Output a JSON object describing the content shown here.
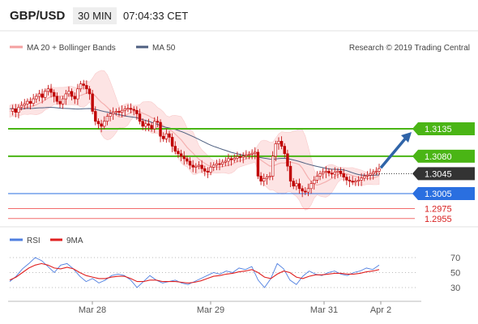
{
  "header": {
    "pair": "GBP/USD",
    "timeframe": "30 MIN",
    "time": "07:04:33 CET"
  },
  "legend": {
    "ma20": "MA 20 + Bollinger Bands",
    "ma50": "MA 50",
    "copyright": "Research © 2019 Trading Central"
  },
  "rsi_legend": {
    "rsi": "RSI",
    "ma9": "9MA"
  },
  "colors": {
    "candle": "#c00000",
    "band_fill": "#fde4e4",
    "ma20": "#f4b0b0",
    "ma50": "#4d5f80",
    "resistance": "#4ab515",
    "pivot": "#2a6fe0",
    "support": "#f26b6b",
    "current": "#333333",
    "arrow": "#2f64a8",
    "rsi": "#4f7fe0",
    "rsi_ma": "#e02020"
  },
  "chart_data": [
    {
      "type": "candlestick",
      "title": "",
      "x_ticks": [
        "Mar 28",
        "Mar 29",
        "Mar 31",
        "Apr 2"
      ],
      "price_levels": [
        {
          "value": 1.3135,
          "label": "1.3135",
          "kind": "resistance"
        },
        {
          "value": 1.308,
          "label": "1.3080",
          "kind": "resistance"
        },
        {
          "value": 1.3045,
          "label": "1.3045",
          "kind": "current"
        },
        {
          "value": 1.3005,
          "label": "1.3005",
          "kind": "pivot"
        },
        {
          "value": 1.2975,
          "label": "1.2975",
          "kind": "support"
        },
        {
          "value": 1.2955,
          "label": "1.2955",
          "kind": "support"
        }
      ],
      "price_series_estimated": [
        1.317,
        1.3175,
        1.3168,
        1.3178,
        1.3182,
        1.3185,
        1.319,
        1.3186,
        1.3195,
        1.32,
        1.3205,
        1.3198,
        1.321,
        1.3215,
        1.3208,
        1.32,
        1.319,
        1.3185,
        1.3195,
        1.3205,
        1.321,
        1.32,
        1.3195,
        1.3215,
        1.3225,
        1.3222,
        1.3215,
        1.3205,
        1.317,
        1.315,
        1.3145,
        1.314,
        1.315,
        1.316,
        1.3165,
        1.3168,
        1.317,
        1.3168,
        1.3172,
        1.3175,
        1.3176,
        1.3174,
        1.3172,
        1.3165,
        1.315,
        1.314,
        1.3145,
        1.3142,
        1.3135,
        1.315,
        1.3148,
        1.312,
        1.3115,
        1.3125,
        1.3118,
        1.31,
        1.309,
        1.3085,
        1.308,
        1.3075,
        1.307,
        1.3062,
        1.3058,
        1.306,
        1.3062,
        1.3055,
        1.305,
        1.3048,
        1.3058,
        1.3062,
        1.3065,
        1.3064,
        1.3068,
        1.307,
        1.3075,
        1.3073,
        1.3076,
        1.3079,
        1.3078,
        1.308,
        1.3082,
        1.3084,
        1.3086,
        1.3088,
        1.304,
        1.303,
        1.3035,
        1.3038,
        1.304,
        1.308,
        1.3105,
        1.311,
        1.31,
        1.3085,
        1.306,
        1.303,
        1.302,
        1.3025,
        1.3015,
        1.301,
        1.3008,
        1.3015,
        1.3025,
        1.3032,
        1.304,
        1.3045,
        1.3048,
        1.305,
        1.3046,
        1.3044,
        1.3048,
        1.305,
        1.3045,
        1.3038,
        1.3032,
        1.303,
        1.3028,
        1.303,
        1.3032,
        1.3036,
        1.304,
        1.3042,
        1.3045,
        1.3048,
        1.305,
        1.3055
      ],
      "ma50_estimated_endpoints": [
        1.318,
        1.3045
      ],
      "projection": {
        "from": 1.305,
        "to": 1.3135
      }
    },
    {
      "type": "line",
      "title": "",
      "y_ticks": [
        30,
        50,
        70
      ],
      "series": [
        {
          "name": "RSI",
          "values": [
            38,
            45,
            55,
            62,
            70,
            66,
            58,
            50,
            60,
            62,
            55,
            45,
            38,
            42,
            36,
            40,
            46,
            48,
            46,
            40,
            30,
            38,
            46,
            40,
            36,
            38,
            40,
            36,
            34,
            38,
            42,
            46,
            50,
            48,
            52,
            50,
            56,
            54,
            58,
            40,
            30,
            42,
            62,
            55,
            40,
            34,
            45,
            52,
            48,
            46,
            50,
            52,
            48,
            46,
            50,
            52,
            56,
            54,
            60
          ]
        },
        {
          "name": "9MA",
          "values": [
            40,
            44,
            50,
            56,
            60,
            62,
            60,
            56,
            55,
            57,
            55,
            50,
            46,
            44,
            42,
            42,
            44,
            45,
            45,
            42,
            38,
            38,
            40,
            40,
            38,
            38,
            38,
            37,
            36,
            37,
            39,
            42,
            45,
            46,
            48,
            49,
            51,
            52,
            54,
            50,
            44,
            42,
            48,
            52,
            50,
            44,
            42,
            45,
            47,
            47,
            48,
            49,
            49,
            48,
            48,
            49,
            51,
            52,
            54
          ]
        }
      ]
    }
  ]
}
